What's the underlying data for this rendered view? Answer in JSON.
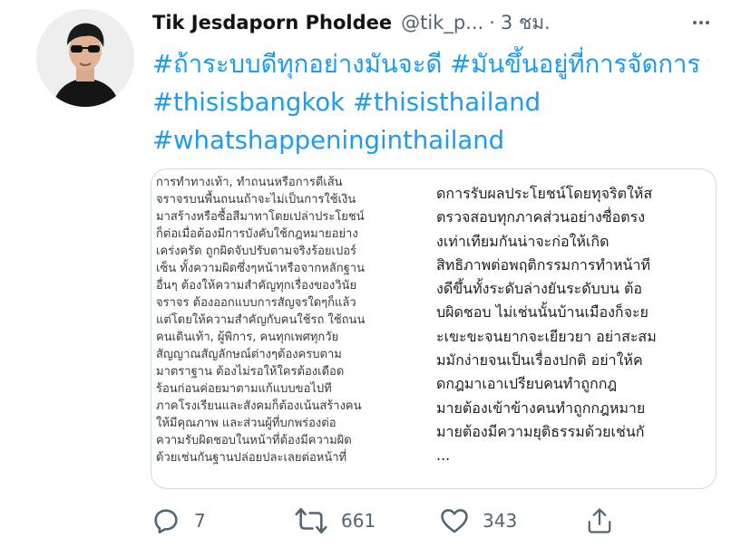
{
  "tweet": {
    "author_name": "Tik Jesdaporn Pholdee",
    "handle": "@tik_p...",
    "separator": "·",
    "time": "3 ชม.",
    "more_icon": "more-dots-icon",
    "hashtags": [
      "#ถ้าระบบดีทุกอย่างมันจะดี",
      "#มันขึ้นอยู่ที่การจัดการ",
      "#thisisbangkok",
      "#thisisthailand",
      "#whatshappeninginthailand"
    ]
  },
  "media": {
    "left_lines": [
      "การทำทางเท้า, ทำถนนหรือการตีเส้น",
      "จราจรบนพื้นถนนถ้าจะไม่เป็นการใช้เงิน",
      "มาสร้างหรือซื้อสีมาทาโดยเปล่าประโยชน์",
      "ก็ต่อเมื่อต้องมีการบังคับใช้กฎหมายอย่าง",
      "เคร่งครัด ถูกผิดจับปรับตามจริงร้อยเปอร์",
      "เซ็น ทั้งความผิดซึ่งๆหน้าหรือจากหลักฐาน",
      "อื่นๆ ต้องให้ความสำคัญทุกเรื่องของวินัย",
      "จราจร ต้องออกแบบการสัญจรใดๆก็แล้ว",
      "แต่โดยให้ความสำคัญกับคนใช้รถ ใช้ถนน",
      "คนเดินเท้า, ผู้พิการ, คนทุกเพศทุกวัย",
      "สัญญาณสัญลักษณ์ต่างๆต้องครบตาม",
      "มาตราฐาน ต้องไม่รอให้ใครต้องเดือด",
      "ร้อนก่อนค่อยมาตามแก้แบบขอไปที",
      "ภาคโรงเรียนและสังคมก็ต้องเน้นสร้างคน",
      "ให้มีคุณภาพ และส่วนผู้ที่บกพร่องต่อ",
      "ความรับผิดชอบในหน้าที่ต้องมีความผิด",
      "ด้วยเช่นกันฐานปล่อยปละเลยต่อหน้าที่"
    ],
    "right_lines": [
      "ัดการรับผลประโยชน์โดยทุจริตให้ส",
      "ตรวจสอบทุกภาคส่วนอย่างซื่อตรง",
      "งเท่าเทียมกันน่าจะก่อให้เกิด",
      "สิทธิภาพต่อพฤติกรรมการทำหน้าที",
      "งดีขึ้นทั้งระดับล่างยันระดับบน ต้อ",
      "บผิดชอบ ไม่เช่นนั้นบ้านเมืองก็จะย",
      "ะเขะขะจนยากจะเยียวยา อย่าสะสม",
      "มมักง่ายจนเป็นเรื่องปกติ อย่าให้ค",
      "ดกฎมาเอาเปรียบคนทำถูกกฎ",
      "มายต้องเข้าข้างคนทำถูกกฎหมาย",
      "มายต้องมีความยุติธรรมด้วยเช่นกั",
      "..."
    ]
  },
  "actions": {
    "reply": {
      "icon": "reply-icon",
      "count": "7"
    },
    "retweet": {
      "icon": "retweet-icon",
      "count": "661"
    },
    "like": {
      "icon": "heart-icon",
      "count": "343"
    },
    "share": {
      "icon": "share-icon"
    }
  },
  "colors": {
    "link": "#1d9bf0",
    "muted": "#536471",
    "text": "#0f1419",
    "border": "#cfd9de"
  }
}
